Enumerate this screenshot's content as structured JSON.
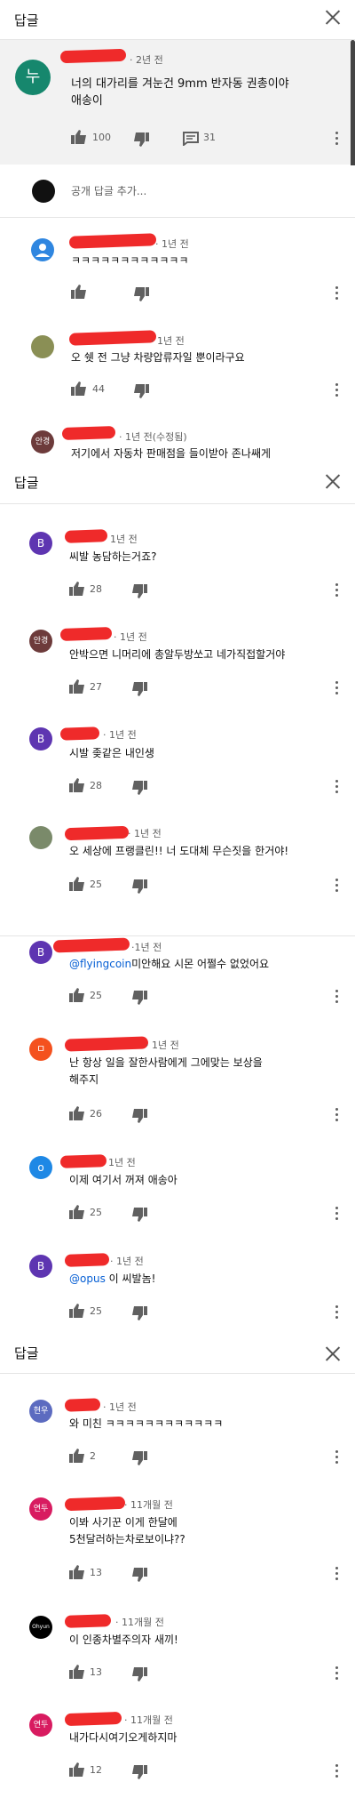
{
  "header": {
    "title": "답글"
  },
  "pinned": {
    "avatar_letter": "누",
    "avatar_color": "#16876d",
    "time": "· 2년 전",
    "text": "너의 대가리를 겨눈건 9mm 반자동 권총이야\n애송이",
    "likes": "100",
    "replies": "31"
  },
  "add_reply": {
    "placeholder": "공개 답글 추가..."
  },
  "panel2": {
    "title": "답글"
  },
  "panel4": {
    "title": "답글"
  },
  "comments": [
    {
      "avatar": "",
      "avatar_color": "#2f86e0",
      "time": "· 1년 전",
      "text": "ㅋㅋㅋㅋㅋㅋㅋㅋㅋㅋㅋㅋ",
      "likes": ""
    },
    {
      "avatar": "",
      "avatar_color": "#8a8f55",
      "time": "· 1년 전",
      "text": "오 쉣 전 그냥 차량압류자일 뿐이라구요",
      "likes": "44"
    },
    {
      "avatar": "안경",
      "avatar_color": "#6d3b3b",
      "time": "· 1년 전(수정됨)",
      "text": "저기에서 자동차 판매점을 들이받아 존나쌔게",
      "likes": ""
    },
    {
      "avatar": "B",
      "avatar_color": "#5e35b1",
      "time": "1년 전",
      "text": "씨발 농담하는거죠?",
      "likes": "28"
    },
    {
      "avatar": "안경",
      "avatar_color": "#6d3b3b",
      "time": "· 1년 전",
      "text": "안박으면 니머리에 총알두방쏘고 네가직접할거야",
      "likes": "27"
    },
    {
      "avatar": "B",
      "avatar_color": "#5e35b1",
      "time": "· 1년 전",
      "text": "시발 좆같은 내인생",
      "likes": "28"
    },
    {
      "avatar": "",
      "avatar_color": "#7a8a6a",
      "time": "· 1년 전",
      "text": "오 세상에 프랭클린!! 너 도대체 무슨짓을 한거야!",
      "likes": "25"
    },
    {
      "avatar": "B",
      "avatar_color": "#5e35b1",
      "time": "·1년 전",
      "mention": "@flyingcoin",
      "text": "미안해요 시몬 어쩔수 없었어요",
      "likes": "25"
    },
    {
      "avatar": "ㅁ",
      "avatar_color": "#f4511e",
      "time": "· 1년 전",
      "text": "난 항상 일을 잘한사람에게 그에맞는 보상을\n해주지",
      "likes": "26"
    },
    {
      "avatar": "o",
      "avatar_color": "#1e88e5",
      "time": "1년 전",
      "text": "이제 여기서 꺼져 애송아",
      "likes": "25"
    },
    {
      "avatar": "B",
      "avatar_color": "#5e35b1",
      "time": "· 1년 전",
      "mention": "@opus",
      "text": " 이 씨발놈!",
      "likes": "25"
    },
    {
      "avatar": "현우",
      "avatar_color": "#5c6bc0",
      "time": "· 1년 전",
      "text": "와 미친 ㅋㅋㅋㅋㅋㅋㅋㅋㅋㅋㅋㅋ",
      "likes": "2"
    },
    {
      "avatar": "연두",
      "avatar_color": "#d81b60",
      "time": "· 11개월 전",
      "text": "이봐 사기꾼 이게 한달에\n5천달러하는차로보이냐??",
      "likes": "13"
    },
    {
      "avatar": "Ohyun",
      "avatar_color": "#000000",
      "time": "· 11개월 전",
      "text": "이 인종차별주의자 새끼!",
      "likes": "13"
    },
    {
      "avatar": "연두",
      "avatar_color": "#d81b60",
      "time": "· 11개월 전",
      "text": "내가다시여기오게하지마",
      "likes": "12"
    }
  ]
}
